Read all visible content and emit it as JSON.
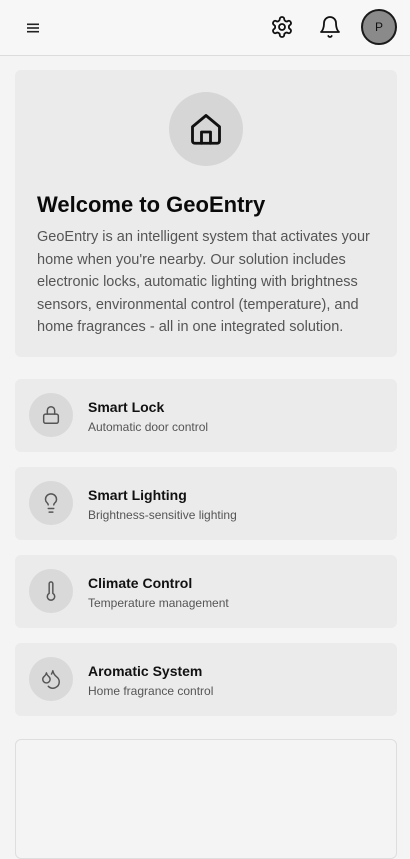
{
  "header": {
    "avatar_initial": "P"
  },
  "welcome": {
    "title": "Welcome to GeoEntry",
    "description": "GeoEntry is an intelligent system that activates your home when you're nearby. Our solution includes electronic locks, automatic lighting with brightness sensors, environmental control (temperature), and home fragrances - all in one integrated solution."
  },
  "features": [
    {
      "title": "Smart Lock",
      "subtitle": "Automatic door control",
      "icon": "lock-icon"
    },
    {
      "title": "Smart Lighting",
      "subtitle": "Brightness-sensitive lighting",
      "icon": "lightbulb-icon"
    },
    {
      "title": "Climate Control",
      "subtitle": "Temperature management",
      "icon": "thermometer-icon"
    },
    {
      "title": "Aromatic System",
      "subtitle": "Home fragrance control",
      "icon": "droplets-icon"
    }
  ],
  "icons": {
    "menu": "menu-icon",
    "settings": "gear-icon",
    "notifications": "bell-icon",
    "home": "home-icon"
  }
}
